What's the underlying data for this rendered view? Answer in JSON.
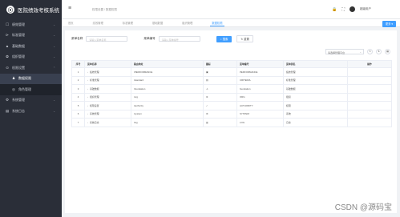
{
  "brand": {
    "logo": "⦿",
    "title": "医院绩效考核系统"
  },
  "sidebar": {
    "items": [
      {
        "icon": "☐",
        "label": "绩效管理"
      },
      {
        "icon": "⊳",
        "label": "标准管理"
      },
      {
        "icon": "▲",
        "label": "基础数据"
      },
      {
        "icon": "✿",
        "label": "组织管理"
      },
      {
        "icon": "⊙",
        "label": "权限设置"
      }
    ],
    "sub": [
      {
        "icon": "♟",
        "label": "数据权限"
      },
      {
        "icon": "◎",
        "label": "角色管理"
      }
    ],
    "after": [
      {
        "icon": "⚙",
        "label": "系统管理"
      },
      {
        "icon": "▤",
        "label": "系统日志"
      }
    ]
  },
  "header": {
    "menu_icon": "≡",
    "breadcrumb": "权限设置 / 数据权限",
    "user": "超级用户"
  },
  "tabs": [
    {
      "label": "首页"
    },
    {
      "label": "绩效管理"
    },
    {
      "label": "标准管理"
    },
    {
      "label": "基础数据"
    },
    {
      "label": "组织管理"
    },
    {
      "label": "数据权限"
    }
  ],
  "tabs_more": "更多 ▾",
  "search": {
    "name_label": "菜单名称",
    "name_placeholder": "请输入菜单名称",
    "code_label": "菜单编号",
    "code_placeholder": "请输入菜单编号",
    "search_btn": "⌕ 搜索",
    "reset_btn": "↻ 重置"
  },
  "tools": {
    "select": "请选择管理平台",
    "refresh": "↻",
    "toggle": "⇅",
    "columns": "▦"
  },
  "table": {
    "headers": [
      "序号",
      "菜单名称",
      "路由地址",
      "图标",
      "菜单编号",
      "菜单别名",
      "操作"
    ],
    "rows": [
      {
        "no": "1",
        "name": "绩效管理",
        "path": "/PERFORMANCE",
        "icon": "▣",
        "code": "PERFORMANCE",
        "alias": "绩效管理"
      },
      {
        "no": "2",
        "name": "标准管理",
        "path": "/standard",
        "icon": "▤",
        "code": "CRITERIA",
        "alias": "标准管理"
      },
      {
        "no": "3",
        "name": "基础数据",
        "path": "/foundation",
        "icon": "♙",
        "code": "foundation",
        "alias": "基础数据"
      },
      {
        "no": "4",
        "name": "组织管理",
        "path": "/org",
        "icon": "⊗",
        "code": "ORG",
        "alias": "组织"
      },
      {
        "no": "5",
        "name": "权限设置",
        "path": "/authority",
        "icon": "✓",
        "code": "AUTHORITY",
        "alias": "权限"
      },
      {
        "no": "6",
        "name": "系统管理",
        "path": "/system",
        "icon": "⚙",
        "code": "SYSTEM",
        "alias": "系统"
      },
      {
        "no": "7",
        "name": "系统日志",
        "path": "/log",
        "icon": "▥",
        "code": "LOG",
        "alias": "日志"
      }
    ]
  },
  "watermark": "CSDN @源码宝",
  "colors": {
    "sidebar": "#2a2e38",
    "accent": "#409eff"
  }
}
